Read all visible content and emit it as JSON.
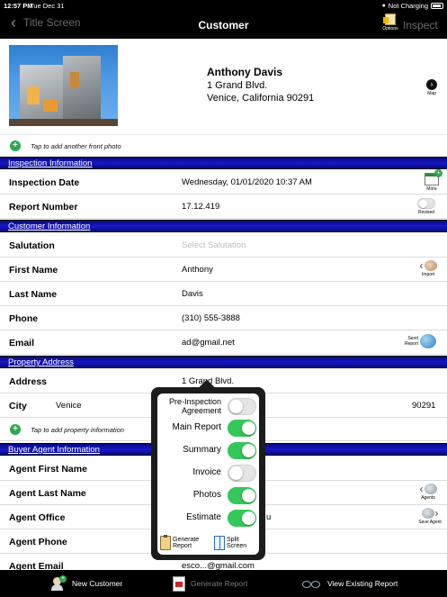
{
  "status_bar": {
    "time": "12:57 PM",
    "date": "Tue Dec 31",
    "charging": "Not Charging"
  },
  "nav": {
    "back_label": "Title Screen",
    "title": "Customer",
    "options_label": "Options",
    "inspect_label": "Inspect"
  },
  "customer": {
    "name": "Anthony Davis",
    "address_line1": "1 Grand Blvd.",
    "address_line2": "Venice, California 90291"
  },
  "map_label": "Map",
  "add_photo_text": "Tap to add another front photo",
  "sections": {
    "inspection": "Inspection Information",
    "customer": "Customer Information",
    "property": "Property Address",
    "buyer_agent": "Buyer Agent Information"
  },
  "inspection": {
    "date_label": "Inspection Date",
    "date_value": "Wednesday, 01/01/2020 10:37 AM",
    "more_label": "More",
    "report_label": "Report Number",
    "report_value": "17.12.419",
    "revised_label": "Revised"
  },
  "customer_info": {
    "salutation_label": "Salutation",
    "salutation_placeholder": "Select Salutation",
    "first_name_label": "First Name",
    "first_name": "Anthony",
    "import_label": "Import",
    "last_name_label": "Last Name",
    "last_name": "Davis",
    "phone_label": "Phone",
    "phone": "(310) 555-3888",
    "email_label": "Email",
    "email": "ad@gmail.net",
    "send_report_label_1": "Send",
    "send_report_label_2": "Report"
  },
  "property": {
    "address_label": "Address",
    "address": "1 Grand Blvd.",
    "city_label": "City",
    "city": "Venice",
    "zip": "90291",
    "add_info_text": "Tap to add property information"
  },
  "buyer_agent": {
    "first_name_label": "Agent First Name",
    "last_name_label": "Agent Last Name",
    "agents_label": "Agents",
    "office_label": "Agent Office",
    "office_partial": "u",
    "save_agent_label": "Save Agent",
    "phone_label": "Agent Phone",
    "email_label": "Agent Email",
    "email_partial": "esco...@gmail.com"
  },
  "popover": {
    "items": [
      {
        "label": "Pre-Inspection Agreement",
        "on": false
      },
      {
        "label": "Main Report",
        "on": true
      },
      {
        "label": "Summary",
        "on": true
      },
      {
        "label": "Invoice",
        "on": false
      },
      {
        "label": "Photos",
        "on": true
      },
      {
        "label": "Estimate",
        "on": true
      }
    ],
    "pre_line1": "Pre-Inspection",
    "pre_line2": "Agreement",
    "generate_line1": "Generate",
    "generate_line2": "Report",
    "split_line1": "Split",
    "split_line2": "Screen"
  },
  "tabbar": {
    "new_customer": "New Customer",
    "generate_report": "Generate Report",
    "view_existing": "View Existing Report"
  }
}
